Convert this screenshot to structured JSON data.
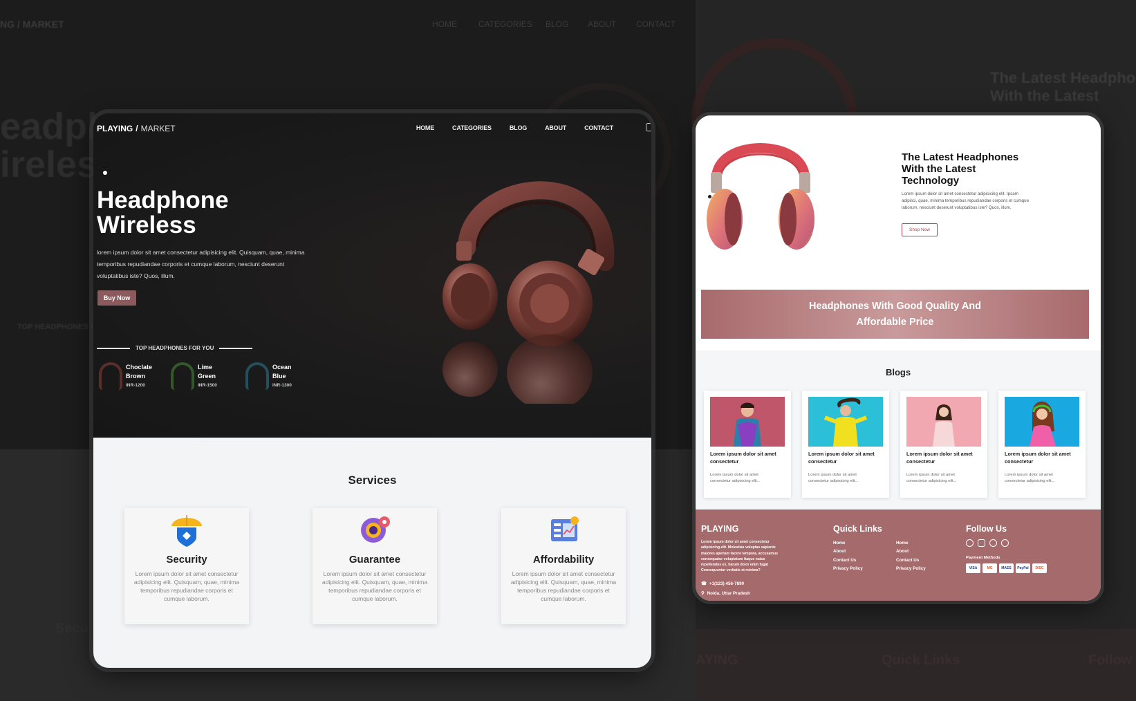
{
  "background": {
    "nav": [
      "HOME",
      "CATEGORIES",
      "BLOG",
      "ABOUT",
      "CONTACT"
    ],
    "logo": "NG / MARKET",
    "hero_fragment_1": "eadph",
    "hero_fragment_2": "ireless",
    "right_heading": "The Latest Headpho",
    "right_heading_2": "With the Latest",
    "footer_brand": "AYING",
    "footer_quick": "Quick Links",
    "footer_follow": "Follow U",
    "services_fragment": "Secu",
    "top_fragment": "TOP HEADPHONES FO"
  },
  "left_card": {
    "logo": {
      "strong": "PLAYING",
      "slash": "/",
      "light": "MARKET"
    },
    "nav": [
      "HOME",
      "CATEGORIES",
      "BLOG",
      "ABOUT",
      "CONTACT"
    ],
    "hero": {
      "title": "Headphone\nWireless",
      "description": "lorem ipsum dolor sit amet consectetur adipisicing elit. Quisquam, quae, minima temporibus repudiandae corporis et cumque laborum, nesciunt deserunt voluptatibus iste? Quos, illum.",
      "cta": "Buy Now"
    },
    "top_heading": "TOP HEADPHONES FOR YOU",
    "products": [
      {
        "name_line1": "Choclate",
        "name_line2": "Brown",
        "price": "INR-1200",
        "color": "#6b3a32"
      },
      {
        "name_line1": "Lime",
        "name_line2": "Green",
        "price": "INR-1500",
        "color": "#3e6b2a"
      },
      {
        "name_line1": "Ocean",
        "name_line2": "Blue",
        "price": "INR-1300",
        "color": "#2d5a6b"
      }
    ],
    "services": {
      "title": "Services",
      "items": [
        {
          "title": "Security",
          "text": "Lorem ipsum dolor sit amet consectetur adipisicing elit. Quisquam, quae, minima temporibus repudiandae corporis et cumque laborum."
        },
        {
          "title": "Guarantee",
          "text": "Lorem ipsum dolor sit amet consectetur adipisicing elit. Quisquam, quae, minima temporibus repudiandae corporis et cumque laborum."
        },
        {
          "title": "Affordability",
          "text": "Lorem ipsum dolor sit amet consectetur adipisicing elit. Quisquam, quae, minima temporibus repudiandae corporis et cumque laborum."
        }
      ]
    }
  },
  "right_card": {
    "hero": {
      "title": "The Latest Headphones\nWith the Latest\nTechnology",
      "description": "Lorem ipsum dolor sit amet consectetur adipisicing elit. Ipsam adipisci, quae, minima temporibus repudiandae corporis et cumque laborum, nesciunt deserunt voluptatibus iste? Quos, illum.",
      "cta": "Shop Now"
    },
    "banner": "Headphones With Good Quality And\nAffordable Price",
    "blogs": {
      "title": "Blogs",
      "items": [
        {
          "title": "Lorem ipsum dolor sit amet consectetur",
          "text": "Lorem ipsum dolor sit amet consectetur adipisicing elit..."
        },
        {
          "title": "Lorem ipsum dolor sit amet consectetur",
          "text": "Lorem ipsum dolor sit amet consectetur adipisicing elit..."
        },
        {
          "title": "Lorem ipsum dolor sit amet consectetur",
          "text": "Lorem ipsum dolor sit amet consectetur adipisicing elit..."
        },
        {
          "title": "Lorem ipsum dolor sit amet consectetur",
          "text": "Lorem ipsum dolor sit amet consectetur adipisicing elit..."
        }
      ]
    },
    "footer": {
      "brand": "PLAYING",
      "about": "Lorem ipsum dolor sit amet consectetur adipisicing elit. Molestias voluptas sapiente maiores aperiam facere tempora, accusamus consequatur voluptatum itaque natus repellendus ex, harum dolor enim fugat Consequuntur veritatis et minima?",
      "phone": "+1(123) 456-7890",
      "location": "Noida, Uttar Pradesh",
      "quick_links_title": "Quick Links",
      "links_col1": [
        "Home",
        "About",
        "Contact Us",
        "Privacy Policy"
      ],
      "links_col2": [
        "Home",
        "About",
        "Contact Us",
        "Privacy Policy"
      ],
      "follow_title": "Follow Us",
      "social_icons": [
        "facebook-icon",
        "instagram-icon",
        "telegram-icon",
        "google-icon"
      ],
      "payment_label": "Payment Methods",
      "payment_methods": [
        "VISA",
        "MC",
        "MAES",
        "PayPal",
        "DISC"
      ]
    }
  },
  "colors": {
    "accent": "#8a5a5c",
    "banner": "#a86a6c",
    "footer": "#a56a6b",
    "shop_border": "#b0434a"
  }
}
